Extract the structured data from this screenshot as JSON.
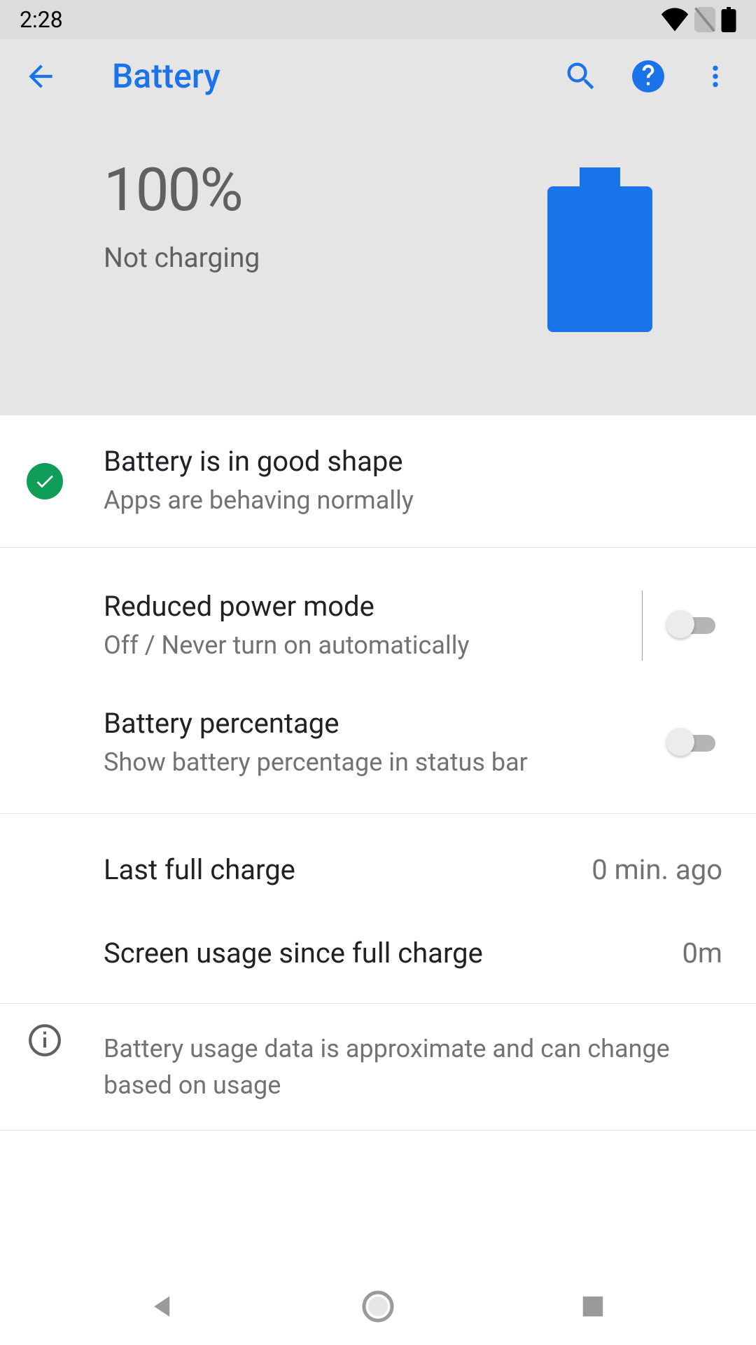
{
  "statusBar": {
    "time": "2:28"
  },
  "appBar": {
    "title": "Battery"
  },
  "hero": {
    "percentage": "100%",
    "status": "Not charging"
  },
  "health": {
    "title": "Battery is in good shape",
    "subtitle": "Apps are behaving normally"
  },
  "settings": {
    "reducedPower": {
      "title": "Reduced power mode",
      "subtitle": "Off / Never turn on automatically",
      "on": false
    },
    "batteryPercentage": {
      "title": "Battery percentage",
      "subtitle": "Show battery percentage in status bar",
      "on": false
    }
  },
  "stats": {
    "lastFullCharge": {
      "label": "Last full charge",
      "value": "0 min. ago"
    },
    "screenUsage": {
      "label": "Screen usage since full charge",
      "value": "0m"
    }
  },
  "footerNote": "Battery usage data is approximate and can change based on usage",
  "colors": {
    "accent": "#1a73e8",
    "success": "#0f9d58",
    "textPrimary": "#202124",
    "textSecondary": "#727272"
  }
}
